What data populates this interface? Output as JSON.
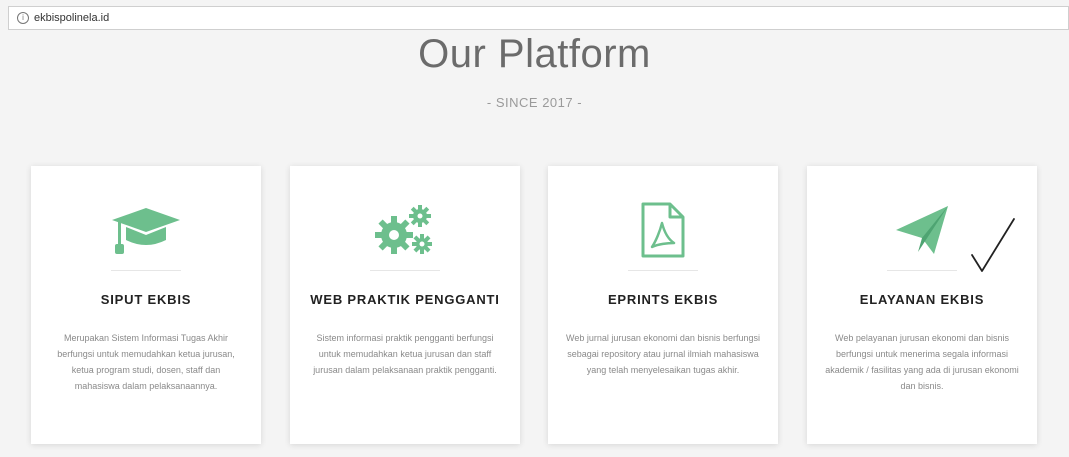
{
  "browser": {
    "url": "ekbispolinela.id"
  },
  "section": {
    "title": "Our Platform",
    "subtitle": "- SINCE 2017 -"
  },
  "colors": {
    "accent": "#6dbf8d",
    "background": "#f4f4f4"
  },
  "cards": [
    {
      "icon": "graduation-cap-icon",
      "title": "SIPUT EKBIS",
      "description": "Merupakan Sistem Informasi Tugas Akhir berfungsi untuk memudahkan ketua jurusan, ketua program studi, dosen, staff dan mahasiswa dalam pelaksanaannya."
    },
    {
      "icon": "gears-icon",
      "title": "WEB PRAKTIK PENGGANTI",
      "description": "Sistem informasi praktik pengganti berfungsi untuk memudahkan ketua jurusan dan staff jurusan dalam pelaksanaan praktik pengganti."
    },
    {
      "icon": "pdf-file-icon",
      "title": "EPRINTS EKBIS",
      "description": "Web jurnal jurusan ekonomi dan bisnis berfungsi sebagai repository atau jurnal ilmiah mahasiswa yang telah menyelesaikan tugas akhir."
    },
    {
      "icon": "paper-plane-icon",
      "title": "ELAYANAN EKBIS",
      "description": "Web pelayanan jurusan ekonomi dan bisnis berfungsi untuk menerima segala informasi akademik / fasilitas yang ada di jurusan ekonomi dan bisnis."
    }
  ]
}
